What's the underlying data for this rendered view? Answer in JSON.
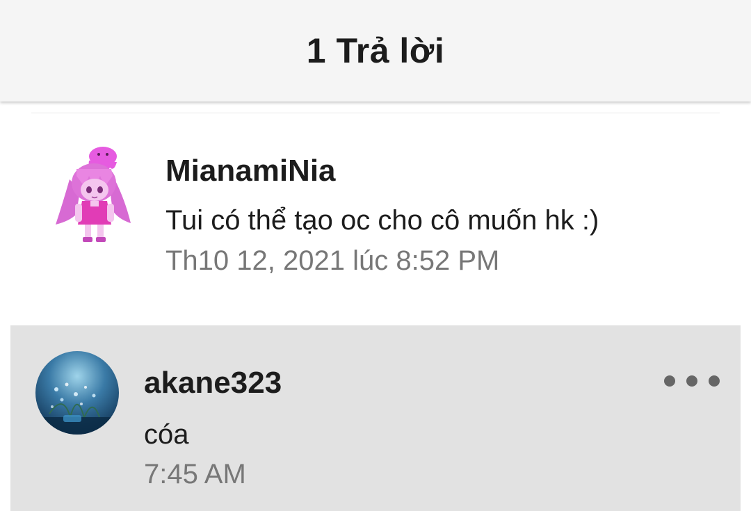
{
  "header": {
    "title": "1 Trả lời"
  },
  "original_post": {
    "username": "MianamiNia",
    "message": "Tui có thể tạo oc cho cô muốn hk :)",
    "timestamp": "Th10 12, 2021 lúc 8:52 PM",
    "avatar": "anime-character-avatar"
  },
  "reply": {
    "username": "akane323",
    "message": "cóa",
    "timestamp": "7:45 AM",
    "avatar": "nature-photo-avatar",
    "more_icon": "more-horizontal-icon"
  },
  "colors": {
    "header_bg": "#f5f5f5",
    "reply_bg": "#e2e2e2",
    "text_primary": "#1c1c1c",
    "text_secondary": "#777777",
    "accent_pink": "#e35fd9"
  }
}
